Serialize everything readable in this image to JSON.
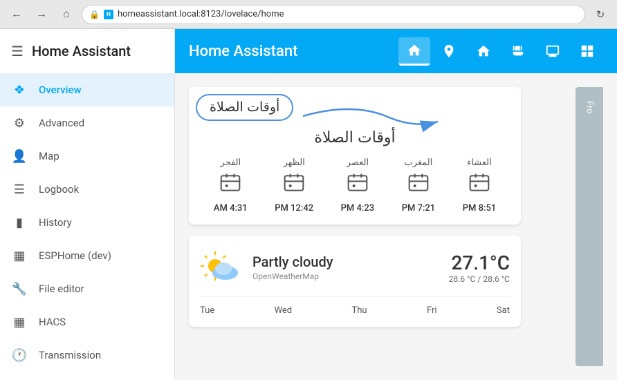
{
  "browser": {
    "url": "homeassistant.local:8123/lovelace/home",
    "back_title": "←",
    "forward_title": "→",
    "home_title": "⌂",
    "reload_title": "↻"
  },
  "sidebar": {
    "title": "Home Assistant",
    "menu_icon": "☰",
    "items": [
      {
        "id": "overview",
        "label": "Overview",
        "icon": "⊞",
        "active": true
      },
      {
        "id": "advanced",
        "label": "Advanced",
        "icon": "⚙",
        "active": false
      },
      {
        "id": "map",
        "label": "Map",
        "icon": "👤",
        "active": false
      },
      {
        "id": "logbook",
        "label": "Logbook",
        "icon": "☰",
        "active": false
      },
      {
        "id": "history",
        "label": "History",
        "icon": "▊",
        "active": false
      },
      {
        "id": "esphome",
        "label": "ESPHome (dev)",
        "icon": "▦",
        "active": false
      },
      {
        "id": "file-editor",
        "label": "File editor",
        "icon": "🔧",
        "active": false
      },
      {
        "id": "hacs",
        "label": "HACS",
        "icon": "▦",
        "active": false
      },
      {
        "id": "transmission",
        "label": "Transmission",
        "icon": "🕐",
        "active": false
      }
    ]
  },
  "topbar": {
    "title": "Home Assistant",
    "tabs": [
      {
        "id": "home",
        "icon": "⌂",
        "active": true
      },
      {
        "id": "person",
        "icon": "⌂",
        "active": false
      },
      {
        "id": "house",
        "icon": "🏠",
        "active": false
      },
      {
        "id": "bathtub",
        "icon": "🛁",
        "active": false
      },
      {
        "id": "monitor",
        "icon": "🖥",
        "active": false
      },
      {
        "id": "grid",
        "icon": "⊞",
        "active": false
      }
    ]
  },
  "prayer_card": {
    "title": "أوقات الصلاة",
    "annotation_text": "أوقات الصلاة",
    "prayers": [
      {
        "name": "الفجر",
        "time": "4:31 AM"
      },
      {
        "name": "الظهر",
        "time": "12:42 PM"
      },
      {
        "name": "العصر",
        "time": "4:23 PM"
      },
      {
        "name": "المغرب",
        "time": "7:21 PM"
      },
      {
        "name": "العشاء",
        "time": "8:51 PM"
      }
    ]
  },
  "weather_card": {
    "condition": "Partly cloudy",
    "source": "OpenWeatherMap",
    "temperature": "27.1°C",
    "range": "28.6 °C / 28.6 °C",
    "days": [
      "Tue",
      "Wed",
      "Thu",
      "Fri",
      "Sat"
    ]
  },
  "right_panel": {
    "label": "Fro"
  }
}
